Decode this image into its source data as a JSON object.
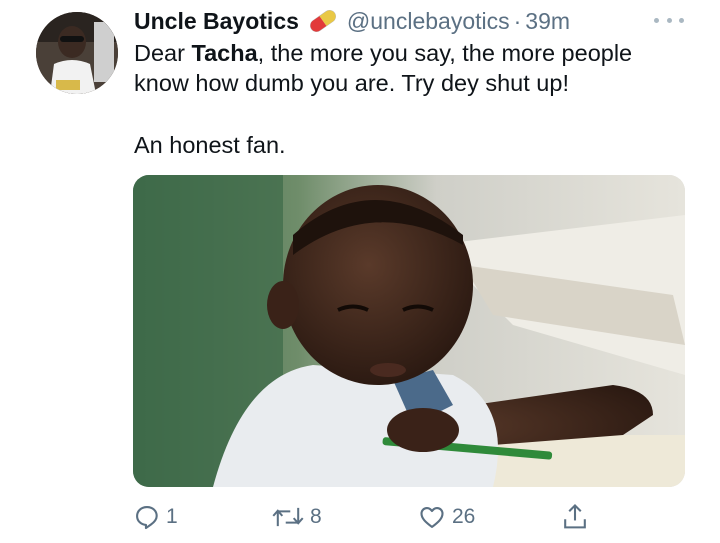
{
  "tweet": {
    "display_name": "Uncle Bayotics",
    "name_emoji": "pill-icon",
    "handle": "@unclebayotics",
    "separator": "·",
    "time": "39m",
    "text_prefix": "Dear ",
    "mention": "Tacha",
    "text_line1_rest": ", the more you say, the more people",
    "text_line2": "know how dumb you are. Try dey shut up!",
    "text_line3": "An honest fan.",
    "media_icon": "photo-child-writing"
  },
  "actions": {
    "reply_icon": "reply-icon",
    "reply_count": "1",
    "retweet_icon": "retweet-icon",
    "retweet_count": "8",
    "like_icon": "heart-icon",
    "like_count": "26",
    "share_icon": "share-icon"
  },
  "colors": {
    "text": "#0f1419",
    "secondary": "#5b7083"
  }
}
